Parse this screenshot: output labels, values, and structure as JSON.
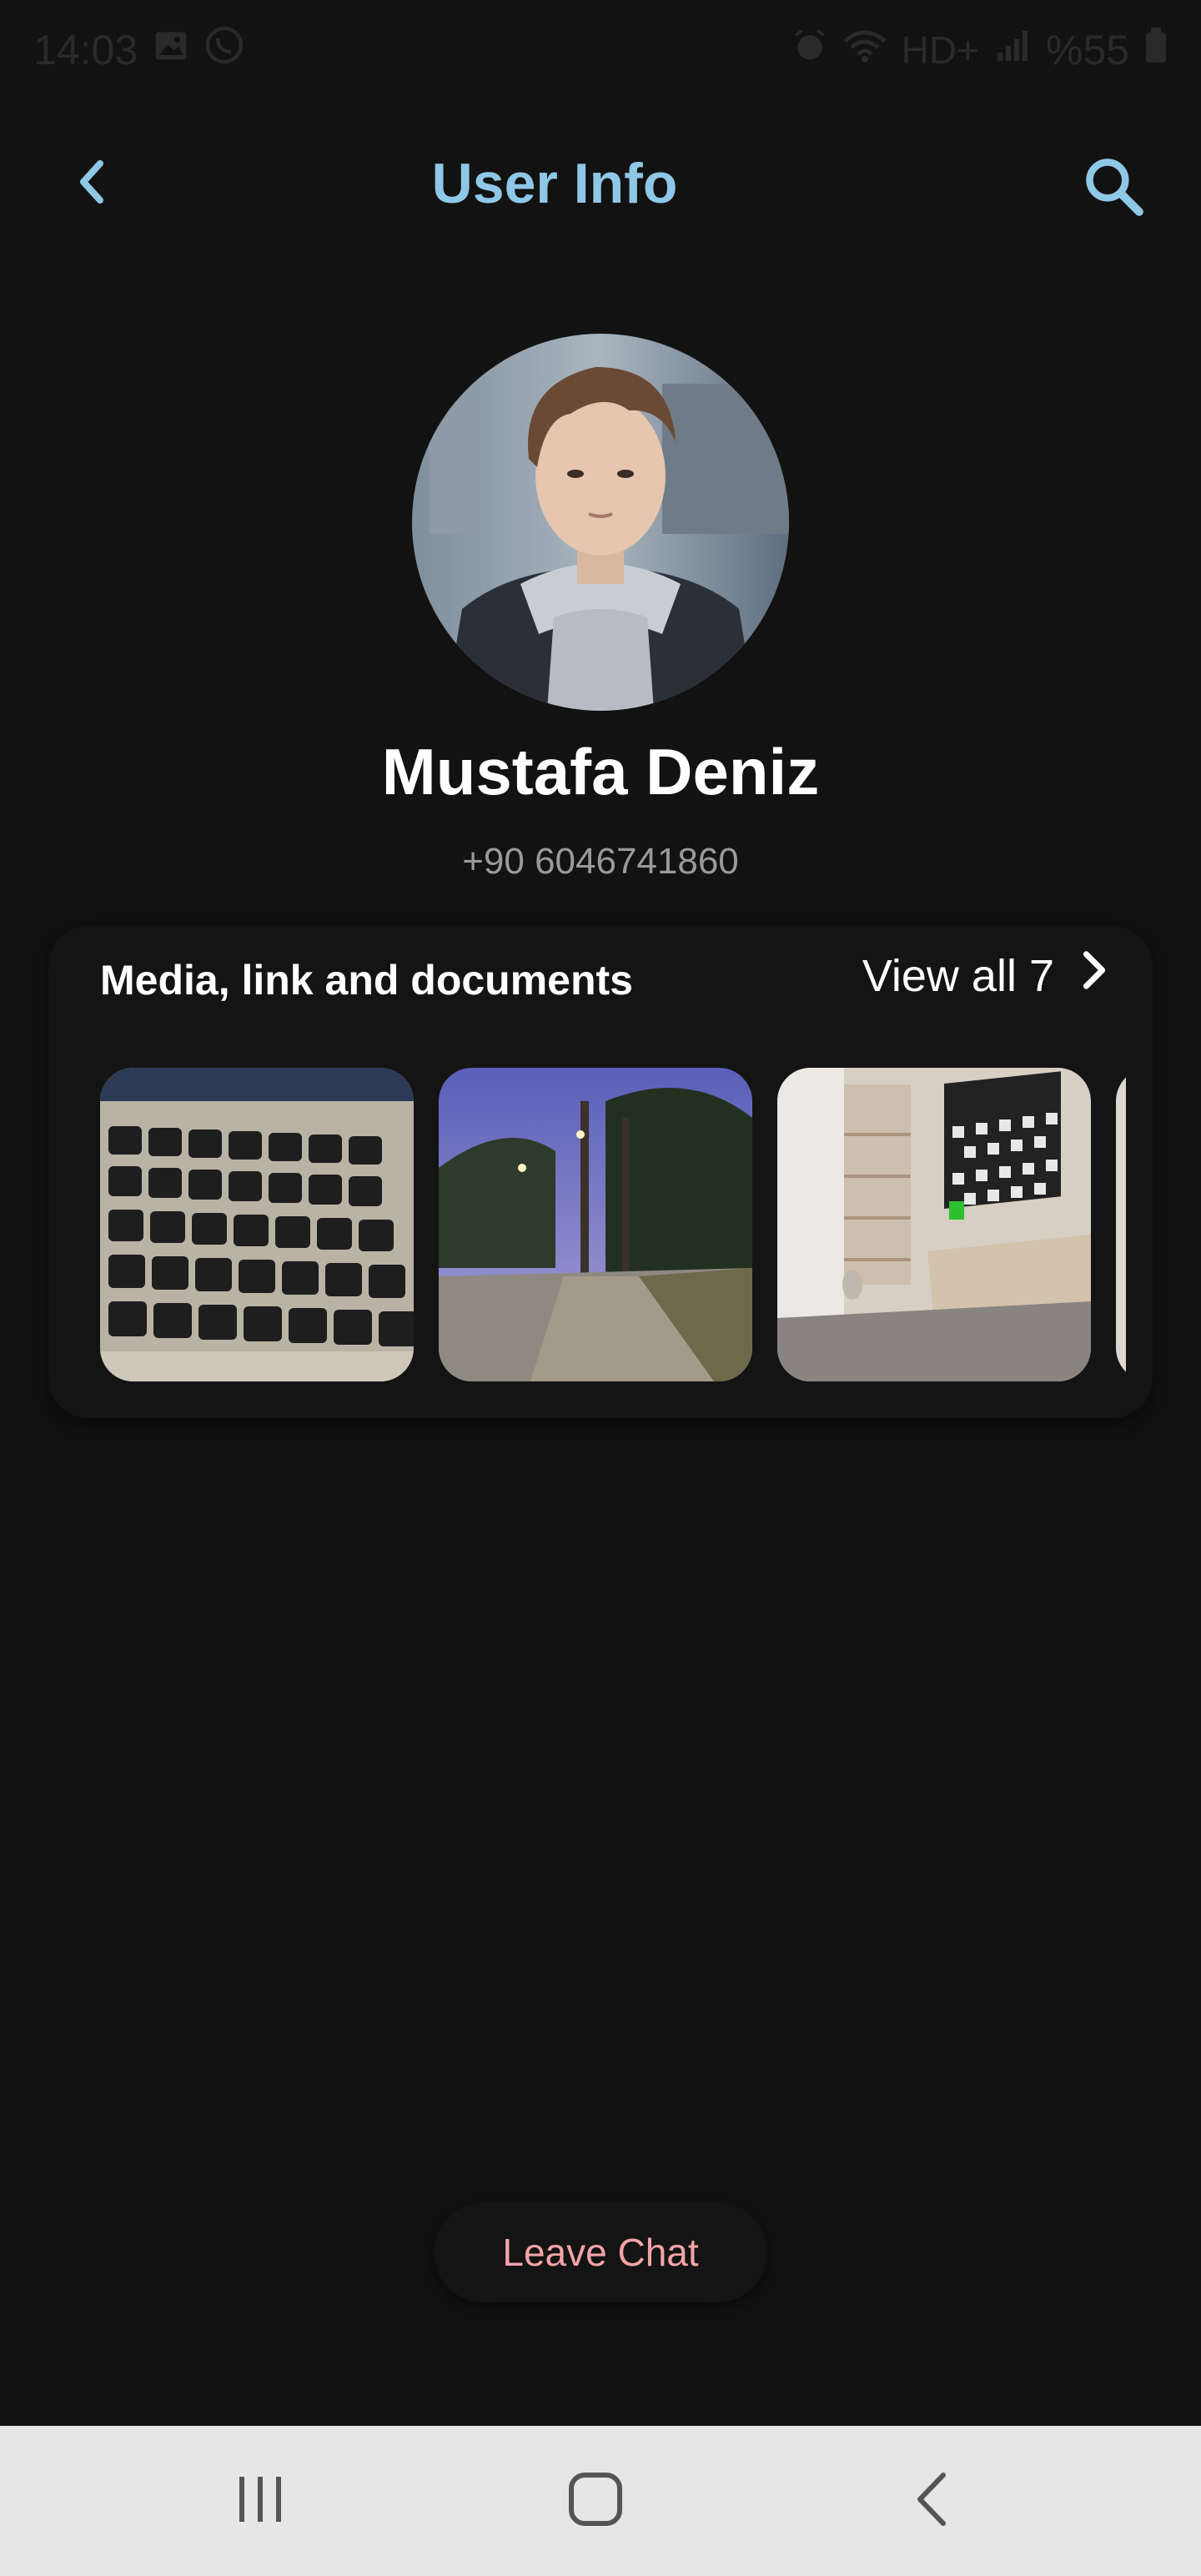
{
  "status_bar": {
    "time": "14:03",
    "battery": "%55",
    "icons": [
      "gallery-icon",
      "whatsapp-icon",
      "alarm-icon",
      "wifi-icon",
      "hd-plus-icon",
      "signal-icon",
      "battery-icon"
    ],
    "hd_label": "HD+"
  },
  "header": {
    "title": "User Info",
    "back_icon": "chevron-left-icon",
    "search_icon": "search-icon"
  },
  "profile": {
    "name": "Mustafa Deniz",
    "phone": "+90 6046741860"
  },
  "media": {
    "title": "Media, link and documents",
    "view_all_label": "View all 7",
    "thumbnails": [
      {
        "subject": "laptop-keyboard"
      },
      {
        "subject": "tree-lined-street-at-dusk"
      },
      {
        "subject": "room-with-tv"
      },
      {
        "subject": "partial-image"
      }
    ]
  },
  "actions": {
    "leave_chat": "Leave Chat"
  },
  "colors": {
    "background": "#121212",
    "accent": "#8fc7e6",
    "danger_text": "#f4a3a8",
    "muted_text": "#9a9a9a",
    "nav_bar": "#e6e6e6"
  }
}
